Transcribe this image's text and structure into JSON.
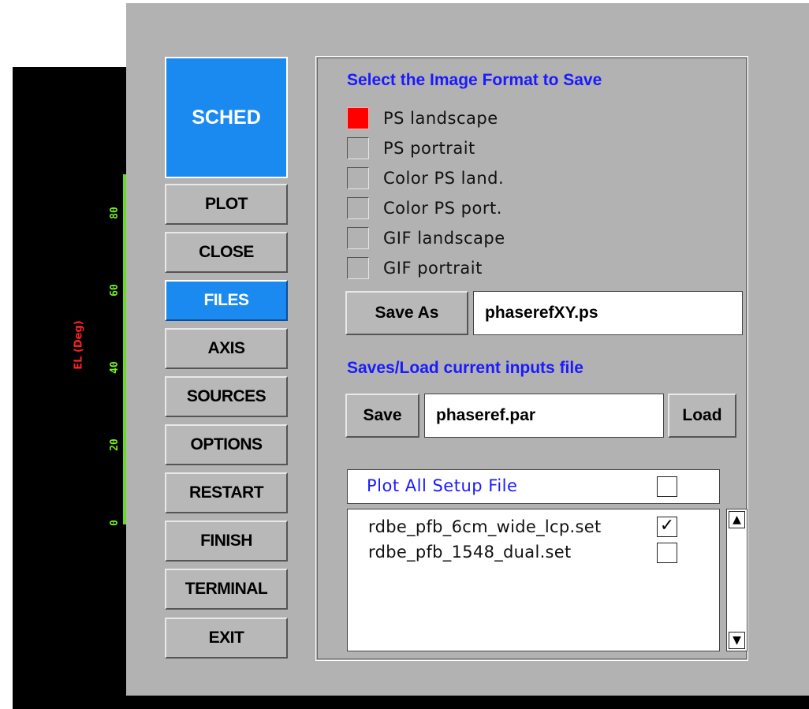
{
  "plot": {
    "y_axis_title": "EL (Deg)",
    "y_ticks": [
      "80",
      "60",
      "40",
      "20",
      "0"
    ],
    "axis_color": "#66dd22",
    "title_color": "#ff2222"
  },
  "nav": {
    "app_label": "SCHED",
    "buttons": [
      {
        "label": "PLOT",
        "active": false
      },
      {
        "label": "CLOSE",
        "active": false
      },
      {
        "label": "FILES",
        "active": true
      },
      {
        "label": "AXIS",
        "active": false
      },
      {
        "label": "SOURCES",
        "active": false
      },
      {
        "label": "OPTIONS",
        "active": false
      },
      {
        "label": "RESTART",
        "active": false
      },
      {
        "label": "FINISH",
        "active": false
      },
      {
        "label": "TERMINAL",
        "active": false
      },
      {
        "label": "EXIT",
        "active": false
      }
    ],
    "active_color": "#1a8af0"
  },
  "format_section": {
    "title": "Select the Image Format to Save",
    "options": [
      {
        "label": "PS landscape",
        "selected": true
      },
      {
        "label": "PS portrait",
        "selected": false
      },
      {
        "label": "Color PS land.",
        "selected": false
      },
      {
        "label": "Color PS port.",
        "selected": false
      },
      {
        "label": "GIF landscape",
        "selected": false
      },
      {
        "label": "GIF portrait",
        "selected": false
      }
    ],
    "save_as_label": "Save As",
    "filename": "phaserefXY.ps"
  },
  "inputs_section": {
    "title": "Saves/Load current inputs file",
    "save_label": "Save",
    "filename": "phaseref.par",
    "load_label": "Load"
  },
  "setup_files": {
    "plot_all_label": "Plot All Setup File",
    "plot_all_checked": false,
    "files": [
      {
        "name": "rdbe_pfb_6cm_wide_lcp.set",
        "checked": true
      },
      {
        "name": "rdbe_pfb_1548_dual.set",
        "checked": false
      }
    ],
    "scroll_up": "▲",
    "scroll_down": "▼",
    "check_mark": "✓"
  },
  "title_color": "#1a1aff"
}
